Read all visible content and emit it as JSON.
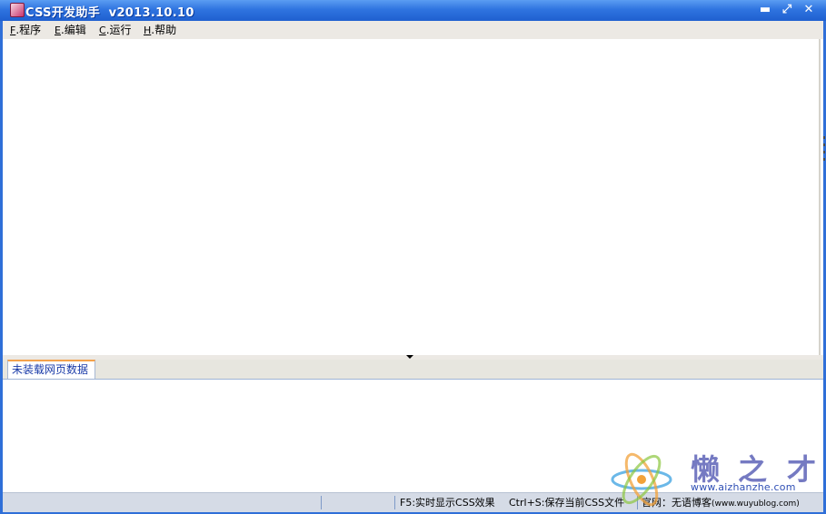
{
  "window": {
    "title": "CSS开发助手  v2013.10.10",
    "controls": {
      "minimize": "▬",
      "restore": "⤢",
      "close": "✕"
    }
  },
  "menu": {
    "items": [
      {
        "key": "F",
        "label": "程序"
      },
      {
        "key": "E",
        "label": "编辑"
      },
      {
        "key": "C",
        "label": "运行"
      },
      {
        "key": "H",
        "label": "帮助"
      }
    ]
  },
  "tabs": {
    "active_label": "未装载网页数据"
  },
  "status": {
    "f5": "F5:实时显示CSS效果",
    "ctrls": "Ctrl+S:保存当前CSS文件",
    "site_label": "官网：无语博客",
    "site_url": "(www.wuyublog.com)"
  },
  "watermark": {
    "glyphs": [
      "懒",
      "之",
      "才"
    ],
    "url": "www.aizhanzhe.com"
  },
  "colors": {
    "title_bar": "#2f74e0",
    "window_border": "#2f6fd8",
    "tab_accent": "#f4a24b",
    "status_bar": "#d5dbe6"
  }
}
